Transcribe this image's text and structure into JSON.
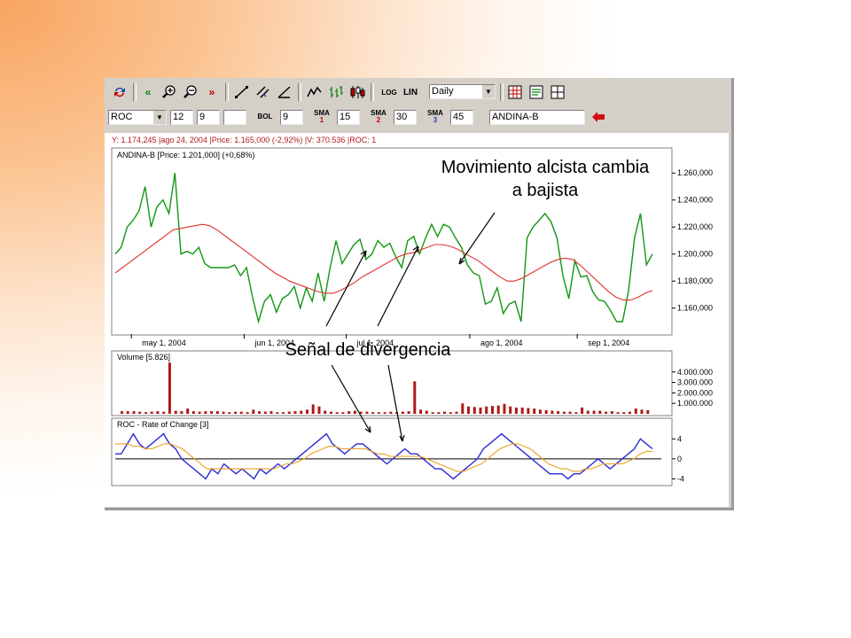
{
  "toolbar": {
    "scale_log": "LOG",
    "scale_lin": "LIN",
    "period": "Daily"
  },
  "indicators": {
    "indicator": "ROC",
    "p1": "12",
    "p2": "9",
    "p3": "",
    "bol_label": "BOL",
    "bol_value": "9",
    "sma1_label": "SMA",
    "sma1_num": "1",
    "sma1_value": "15",
    "sma2_label": "SMA",
    "sma2_num": "2",
    "sma2_value": "30",
    "sma3_label": "SMA",
    "sma3_num": "3",
    "sma3_value": "45",
    "symbol": "ANDINA-B"
  },
  "status_line": "Y: 1.174,245 |ago 24, 2004 |Price: 1.165,000 (-2,92%) |V: 370.536 |ROC: 1",
  "annotations": {
    "bearish_line1": "Movimiento alcista cambia",
    "bearish_line2": "a bajista",
    "divergence": "Señal de divergencia"
  },
  "chart_data": [
    {
      "type": "line",
      "title": "ANDINA-B [Price: 1.201,000] (+0,68%)",
      "x_tick_labels": [
        "may 1, 2004",
        "jun 1, 2004",
        "jul 1, 2004",
        "ago 1, 2004",
        "sep 1, 2004"
      ],
      "y_tick_labels": [
        "1.260,000",
        "1.240,000",
        "1.220,000",
        "1.200,000",
        "1.180,000",
        "1.160,000"
      ],
      "ylim": [
        1148000,
        1270000
      ],
      "series": [
        {
          "color": "#129612",
          "values": [
            1200000,
            1205000,
            1220000,
            1225000,
            1232000,
            1250000,
            1220000,
            1235000,
            1240000,
            1230000,
            1260000,
            1200000,
            1202000,
            1200000,
            1205000,
            1193000,
            1190000,
            1190000,
            1190000,
            1190000,
            1192000,
            1184000,
            1190000,
            1168000,
            1150000,
            1165000,
            1170000,
            1157000,
            1167000,
            1170000,
            1176000,
            1160000,
            1175000,
            1165000,
            1186000,
            1165000,
            1190000,
            1210000,
            1193000,
            1200000,
            1207000,
            1211000,
            1196000,
            1200000,
            1210000,
            1205000,
            1208000,
            1198000,
            1190000,
            1210000,
            1213000,
            1200000,
            1212000,
            1222000,
            1213000,
            1222000,
            1220000,
            1212000,
            1205000,
            1192000,
            1186000,
            1184000,
            1163000,
            1165000,
            1175000,
            1156000,
            1163000,
            1165000,
            1150000,
            1212000,
            1220000,
            1225000,
            1230000,
            1224000,
            1212000,
            1184000,
            1167000,
            1195000,
            1183000,
            1184000,
            1172000,
            1166000,
            1165000,
            1158000,
            1150000,
            1150000,
            1173000,
            1212000,
            1230000,
            1192000,
            1200000
          ]
        },
        {
          "color": "#e03030",
          "values": [
            1186000,
            1190000,
            1194000,
            1198000,
            1202000,
            1206000,
            1210000,
            1214000,
            1218000,
            1219000,
            1220000,
            1221000,
            1222000,
            1221000,
            1218000,
            1214000,
            1210000,
            1206000,
            1202000,
            1198000,
            1194000,
            1190000,
            1186000,
            1183000,
            1180000,
            1178000,
            1176000,
            1174000,
            1172000,
            1171000,
            1171000,
            1173000,
            1176000,
            1179000,
            1183000,
            1186000,
            1189000,
            1192000,
            1195000,
            1198000,
            1200000,
            1201000,
            1203000,
            1205000,
            1207000,
            1207000,
            1206000,
            1204000,
            1201000,
            1198000,
            1195000,
            1191000,
            1187000,
            1183000,
            1180000,
            1180000,
            1182000,
            1185000,
            1188000,
            1191000,
            1194000,
            1196000,
            1197000,
            1196000,
            1192000,
            1187000,
            1182000,
            1177000,
            1172000,
            1168000,
            1166000,
            1166000,
            1168000,
            1171000,
            1173000
          ]
        }
      ]
    },
    {
      "type": "bar",
      "title": "Volume [5.826]",
      "y_tick_labels": [
        "4.000.000",
        "3.000.000",
        "2.000.000",
        "1.000.000"
      ],
      "ylim": [
        0,
        5000000
      ],
      "series": [
        {
          "color": "#b01818",
          "values": [
            250000,
            250000,
            250000,
            200000,
            150000,
            200000,
            250000,
            200000,
            4900000,
            300000,
            250000,
            500000,
            250000,
            200000,
            250000,
            250000,
            250000,
            200000,
            150000,
            200000,
            200000,
            150000,
            400000,
            250000,
            200000,
            250000,
            150000,
            150000,
            200000,
            250000,
            300000,
            400000,
            900000,
            700000,
            300000,
            200000,
            150000,
            150000,
            250000,
            300000,
            200000,
            200000,
            150000,
            150000,
            150000,
            200000,
            150000,
            200000,
            250000,
            3100000,
            400000,
            300000,
            150000,
            150000,
            200000,
            150000,
            200000,
            1000000,
            700000,
            650000,
            600000,
            700000,
            750000,
            800000,
            950000,
            700000,
            600000,
            600000,
            550000,
            500000,
            400000,
            350000,
            300000,
            250000,
            200000,
            200000,
            150000,
            600000,
            300000,
            300000,
            300000,
            200000,
            250000,
            150000,
            150000,
            200000,
            500000,
            400000,
            350000
          ]
        }
      ]
    },
    {
      "type": "line",
      "title": "ROC - Rate of Change [3]",
      "y_tick_labels": [
        "4",
        "0",
        "-4"
      ],
      "ylim": [
        -5,
        6
      ],
      "series": [
        {
          "color": "#2b2bd8",
          "values": [
            1,
            1,
            3,
            5,
            3,
            2,
            3,
            4,
            5,
            3,
            2,
            0,
            -1,
            -2,
            -3,
            -4,
            -2,
            -3,
            -1,
            -2,
            -3,
            -2,
            -3,
            -4,
            -2,
            -3,
            -2,
            -1,
            -2,
            -1,
            0,
            1,
            2,
            3,
            4,
            5,
            3,
            2,
            1,
            2,
            3,
            3,
            2,
            1,
            0,
            -1,
            0,
            1,
            2,
            1,
            1,
            0,
            -1,
            -2,
            -2,
            -3,
            -4,
            -3,
            -2,
            -1,
            0,
            2,
            3,
            4,
            5,
            4,
            3,
            2,
            1,
            0,
            -1,
            -2,
            -3,
            -3,
            -3,
            -4,
            -3,
            -3,
            -2,
            -1,
            0,
            -1,
            -2,
            -1,
            0,
            1,
            2,
            4,
            3,
            2
          ]
        },
        {
          "color": "#e8a020",
          "values": [
            3,
            3,
            3,
            2.5,
            2.5,
            2,
            2,
            2.5,
            3,
            3,
            2.5,
            2,
            1,
            0,
            -1,
            -2,
            -2,
            -2,
            -2,
            -2,
            -2,
            -2,
            -2,
            -2,
            -2,
            -2,
            -2,
            -1.5,
            -1,
            -1,
            -0.5,
            0,
            1,
            1.5,
            2,
            2.5,
            2.5,
            2,
            2,
            2,
            2,
            2,
            1.5,
            1,
            1,
            0.5,
            0.5,
            0.5,
            0.5,
            0.5,
            0.5,
            0,
            -0.5,
            -1,
            -1.5,
            -2,
            -2.5,
            -2.5,
            -2,
            -1.5,
            -1,
            0,
            1,
            2,
            2.5,
            3,
            3,
            2.5,
            2,
            1,
            0,
            -1,
            -1.5,
            -2,
            -2,
            -2.5,
            -2.5,
            -2,
            -2,
            -1.5,
            -1,
            -1,
            -1,
            -1,
            -0.5,
            0,
            1,
            1.5,
            1.5
          ]
        }
      ]
    }
  ]
}
